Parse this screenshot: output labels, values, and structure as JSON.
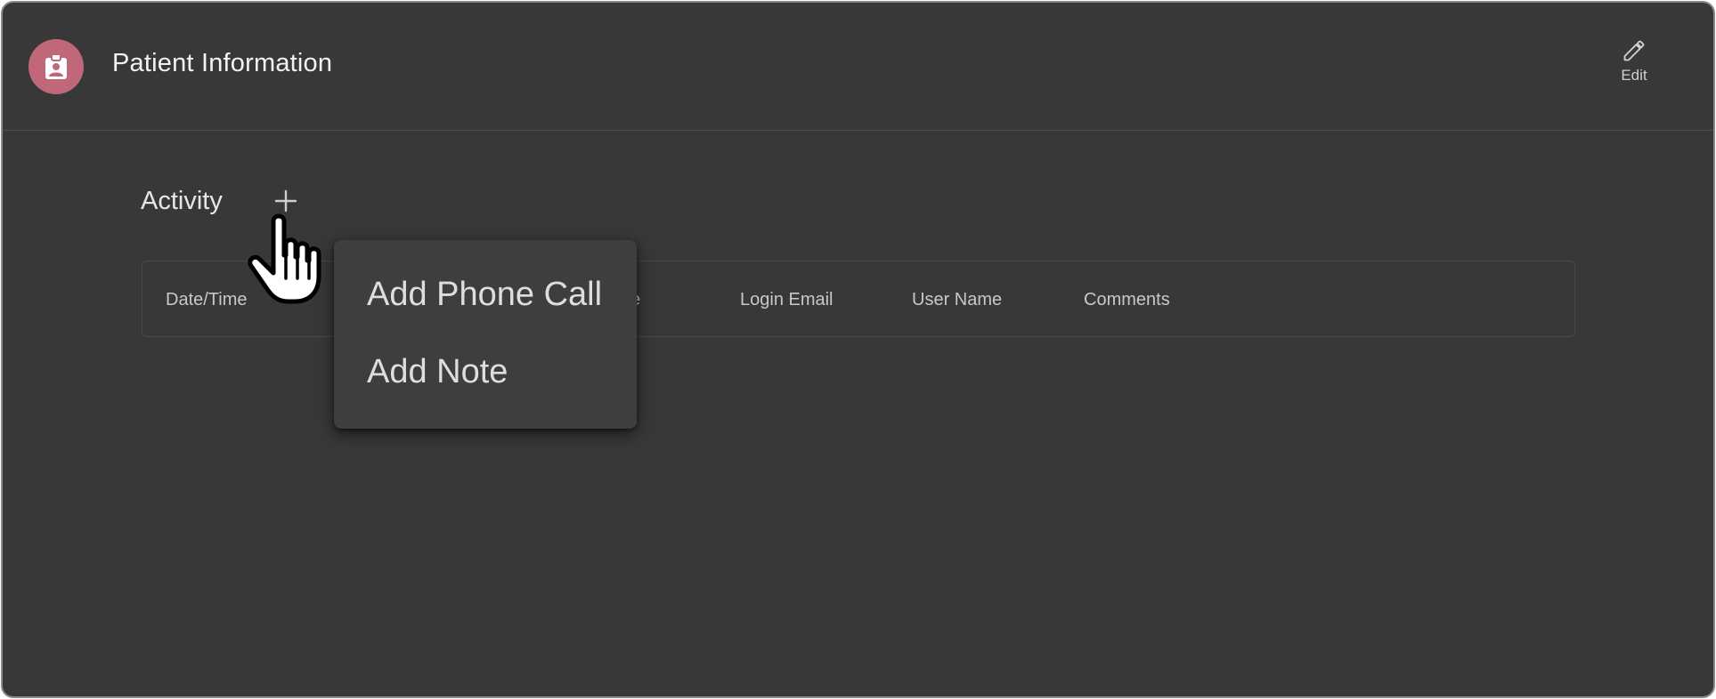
{
  "header": {
    "title": "Patient Information",
    "avatar_icon": "clipboard-account-icon",
    "avatar_color": "#c0687a",
    "edit_label": "Edit",
    "edit_icon": "pencil-icon"
  },
  "activity": {
    "title": "Activity",
    "add_icon": "plus-icon",
    "columns": [
      "Date/Time",
      "e",
      "Login Email",
      "User Name",
      "Comments"
    ]
  },
  "menu": {
    "items": [
      {
        "label": "Add Phone Call"
      },
      {
        "label": "Add Note"
      }
    ]
  },
  "cursor_icon": "hand-pointer-icon",
  "colors": {
    "background": "#383838",
    "text": "#e6e6e6",
    "menu_bg": "#3e3e3e"
  }
}
